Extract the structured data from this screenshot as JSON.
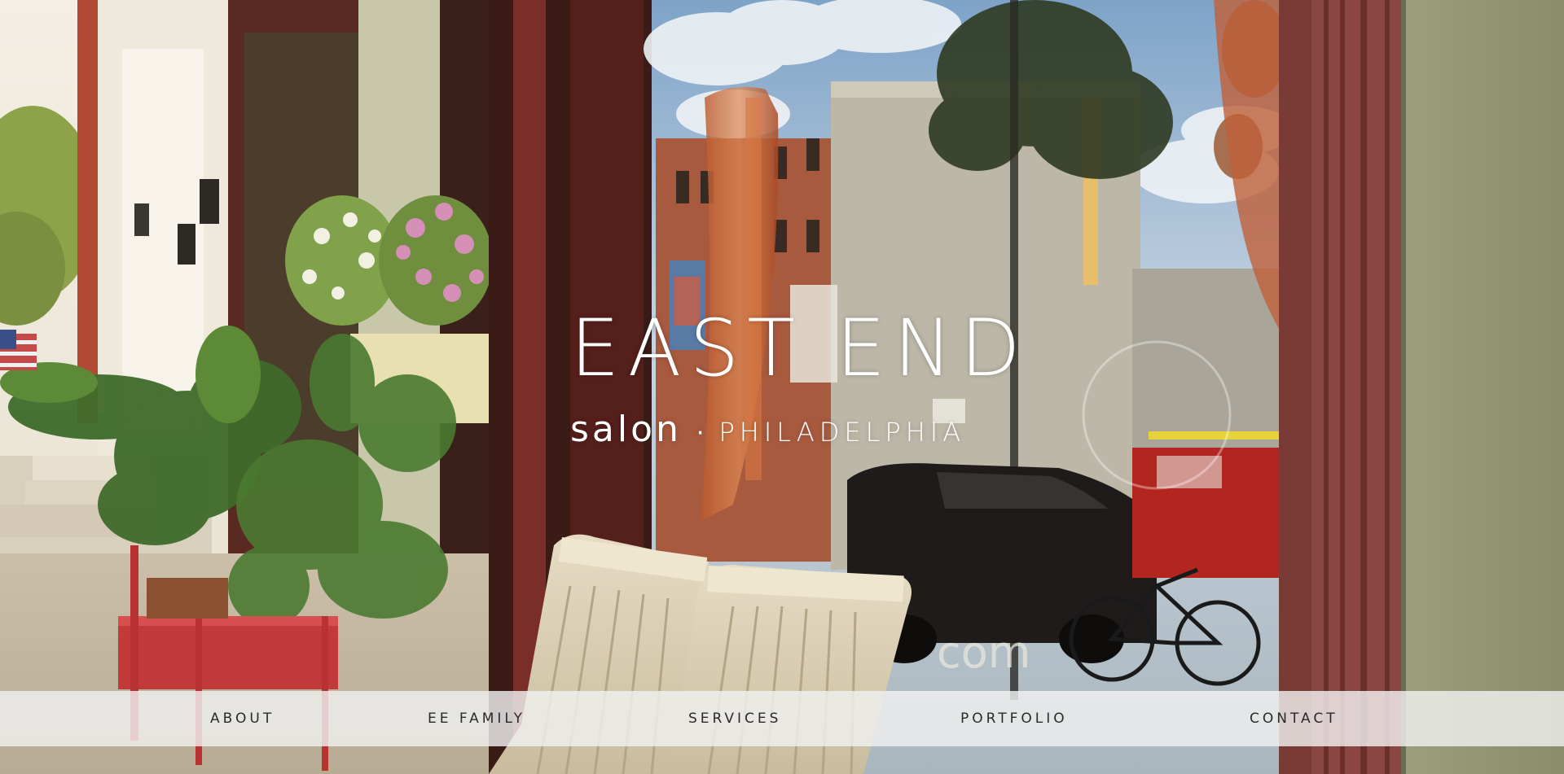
{
  "brand": {
    "title": "EAST END",
    "salon": "salon",
    "separator": "·",
    "city": "PHILADELPHIA"
  },
  "nav": {
    "items": [
      {
        "label": "ABOUT"
      },
      {
        "label": "EE FAMILY"
      },
      {
        "label": "SERVICES"
      },
      {
        "label": "PORTFOLIO"
      },
      {
        "label": "CONTACT"
      }
    ]
  },
  "colors": {
    "brand_text": "#ffffff",
    "nav_background": "#f0f0f0",
    "nav_text": "#2a2a2a"
  }
}
